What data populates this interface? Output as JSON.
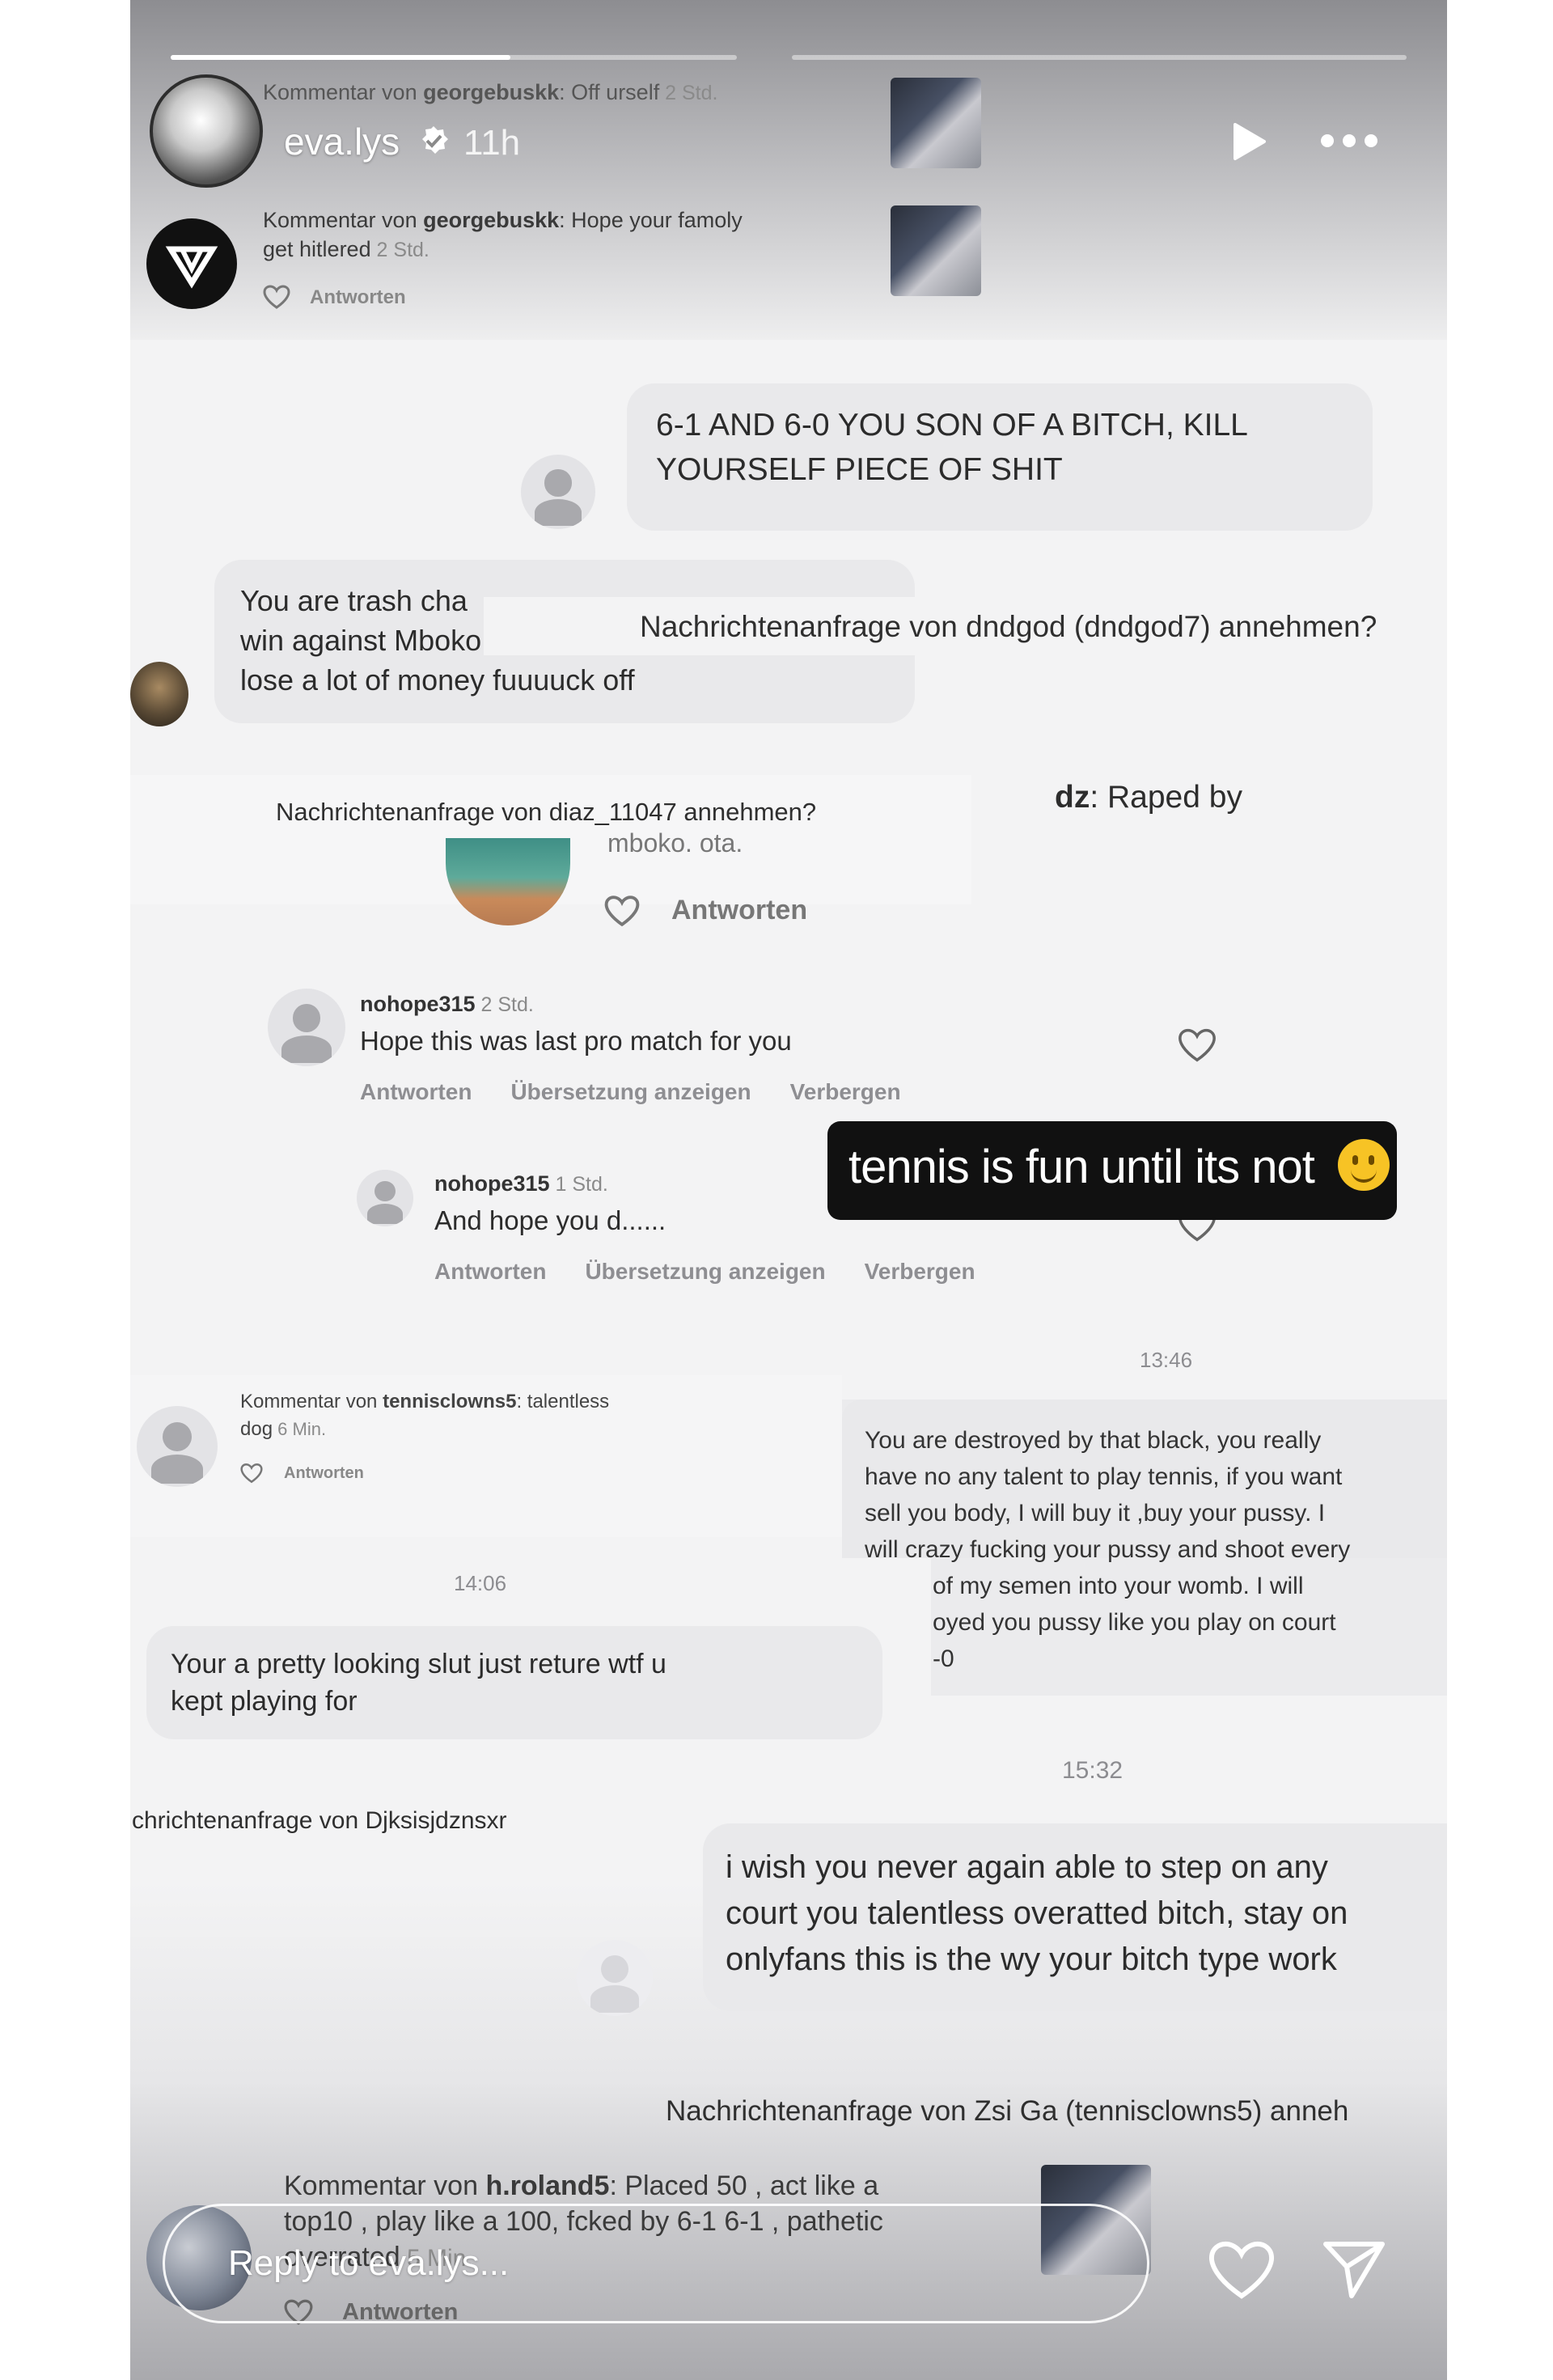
{
  "story": {
    "username": "eva.lys",
    "time_ago": "11h",
    "reply_placeholder": "Reply to eva.lys...",
    "sticker_text": "tennis is fun until its not",
    "sticker_emoji": "🙂"
  },
  "comments": {
    "c1": {
      "prefix": "Kommentar von ",
      "user": "georgebuskk",
      "text": ": Off urself",
      "time": " 2 Std."
    },
    "c2": {
      "prefix": "Kommentar von ",
      "user": "georgebuskk",
      "text": ": Hope your famoly",
      "text2": "get hitlered",
      "time": " 2 Std.",
      "reply": "Antworten"
    },
    "c3": {
      "prefix": "Kommentar von ",
      "user": "tennisclowns5",
      "text": ": talentless",
      "text2": "dog",
      "time": " 6 Min.",
      "reply": "Antworten"
    },
    "c4": {
      "prefix": "Kommentar von ",
      "user": "h.roland5",
      "text": ": Placed 50 , act like a",
      "text2": "top10 , play like a 100, fcked by 6-1 6-1 , pathetic",
      "text3": "overrated",
      "time": " 5 Min.",
      "reply": "Antworten"
    }
  },
  "messages": {
    "m1": {
      "line1": "6-1 AND 6-0 YOU SON OF A BITCH, KILL",
      "line2": "YOURSELF PIECE OF SHIT"
    },
    "m2": {
      "line1": "You are trash cha",
      "line2": "win against Mboko",
      "line3": "lose a lot of money fuuuuck off"
    },
    "m3": {
      "line1": "You are destroyed by that black, you really",
      "line2": "have no any talent to play tennis, if you want",
      "line3": "sell you body, I will buy it ,buy your pussy.  I",
      "line4": "will crazy fucking your pussy and shoot every",
      "line5": "of my semen into your womb. I will",
      "line6": "oyed you pussy like you play on court",
      "line7": "-0"
    },
    "m4": {
      "line1": "Your a pretty looking slut just reture wtf u",
      "line2": "kept playing for"
    },
    "m5": {
      "line1": "i wish you never again able to step on any",
      "line2": "court you talentless overatted bitch, stay on",
      "line3": "onlyfans this is the wy your bitch type work"
    }
  },
  "requests": {
    "r1": "Nachrichtenanfrage von dndgod (dndgod7) annehmen?",
    "r2": "Nachrichtenanfrage von diaz_11047 annehmen?",
    "r3": "chrichtenanfrage von Djksisjdznsxr",
    "r4": "Nachrichtenanfrage von Zsi Ga (tennisclowns5) anneh"
  },
  "fragment": {
    "user": "dz",
    "text": ": Raped by",
    "under": "mboko. ota."
  },
  "antworten": "Antworten",
  "thread": {
    "t1": {
      "user": "nohope315",
      "time": " 2 Std.",
      "text": "Hope this was last pro match for you"
    },
    "t2": {
      "user": "nohope315",
      "time": " 1 Std.",
      "text": "And hope you d......"
    },
    "actions": {
      "reply": "Antworten",
      "translate": "Übersetzung anzeigen",
      "hide": "Verbergen"
    }
  },
  "timestamps": {
    "t1": "13:46",
    "t2": "14:06",
    "t3": "15:32"
  },
  "colors": {
    "sticker_bg": "#111111",
    "sticker_text": "#ffffff",
    "bubble": "#e9e9eb",
    "progress_active": "#ffffff"
  }
}
